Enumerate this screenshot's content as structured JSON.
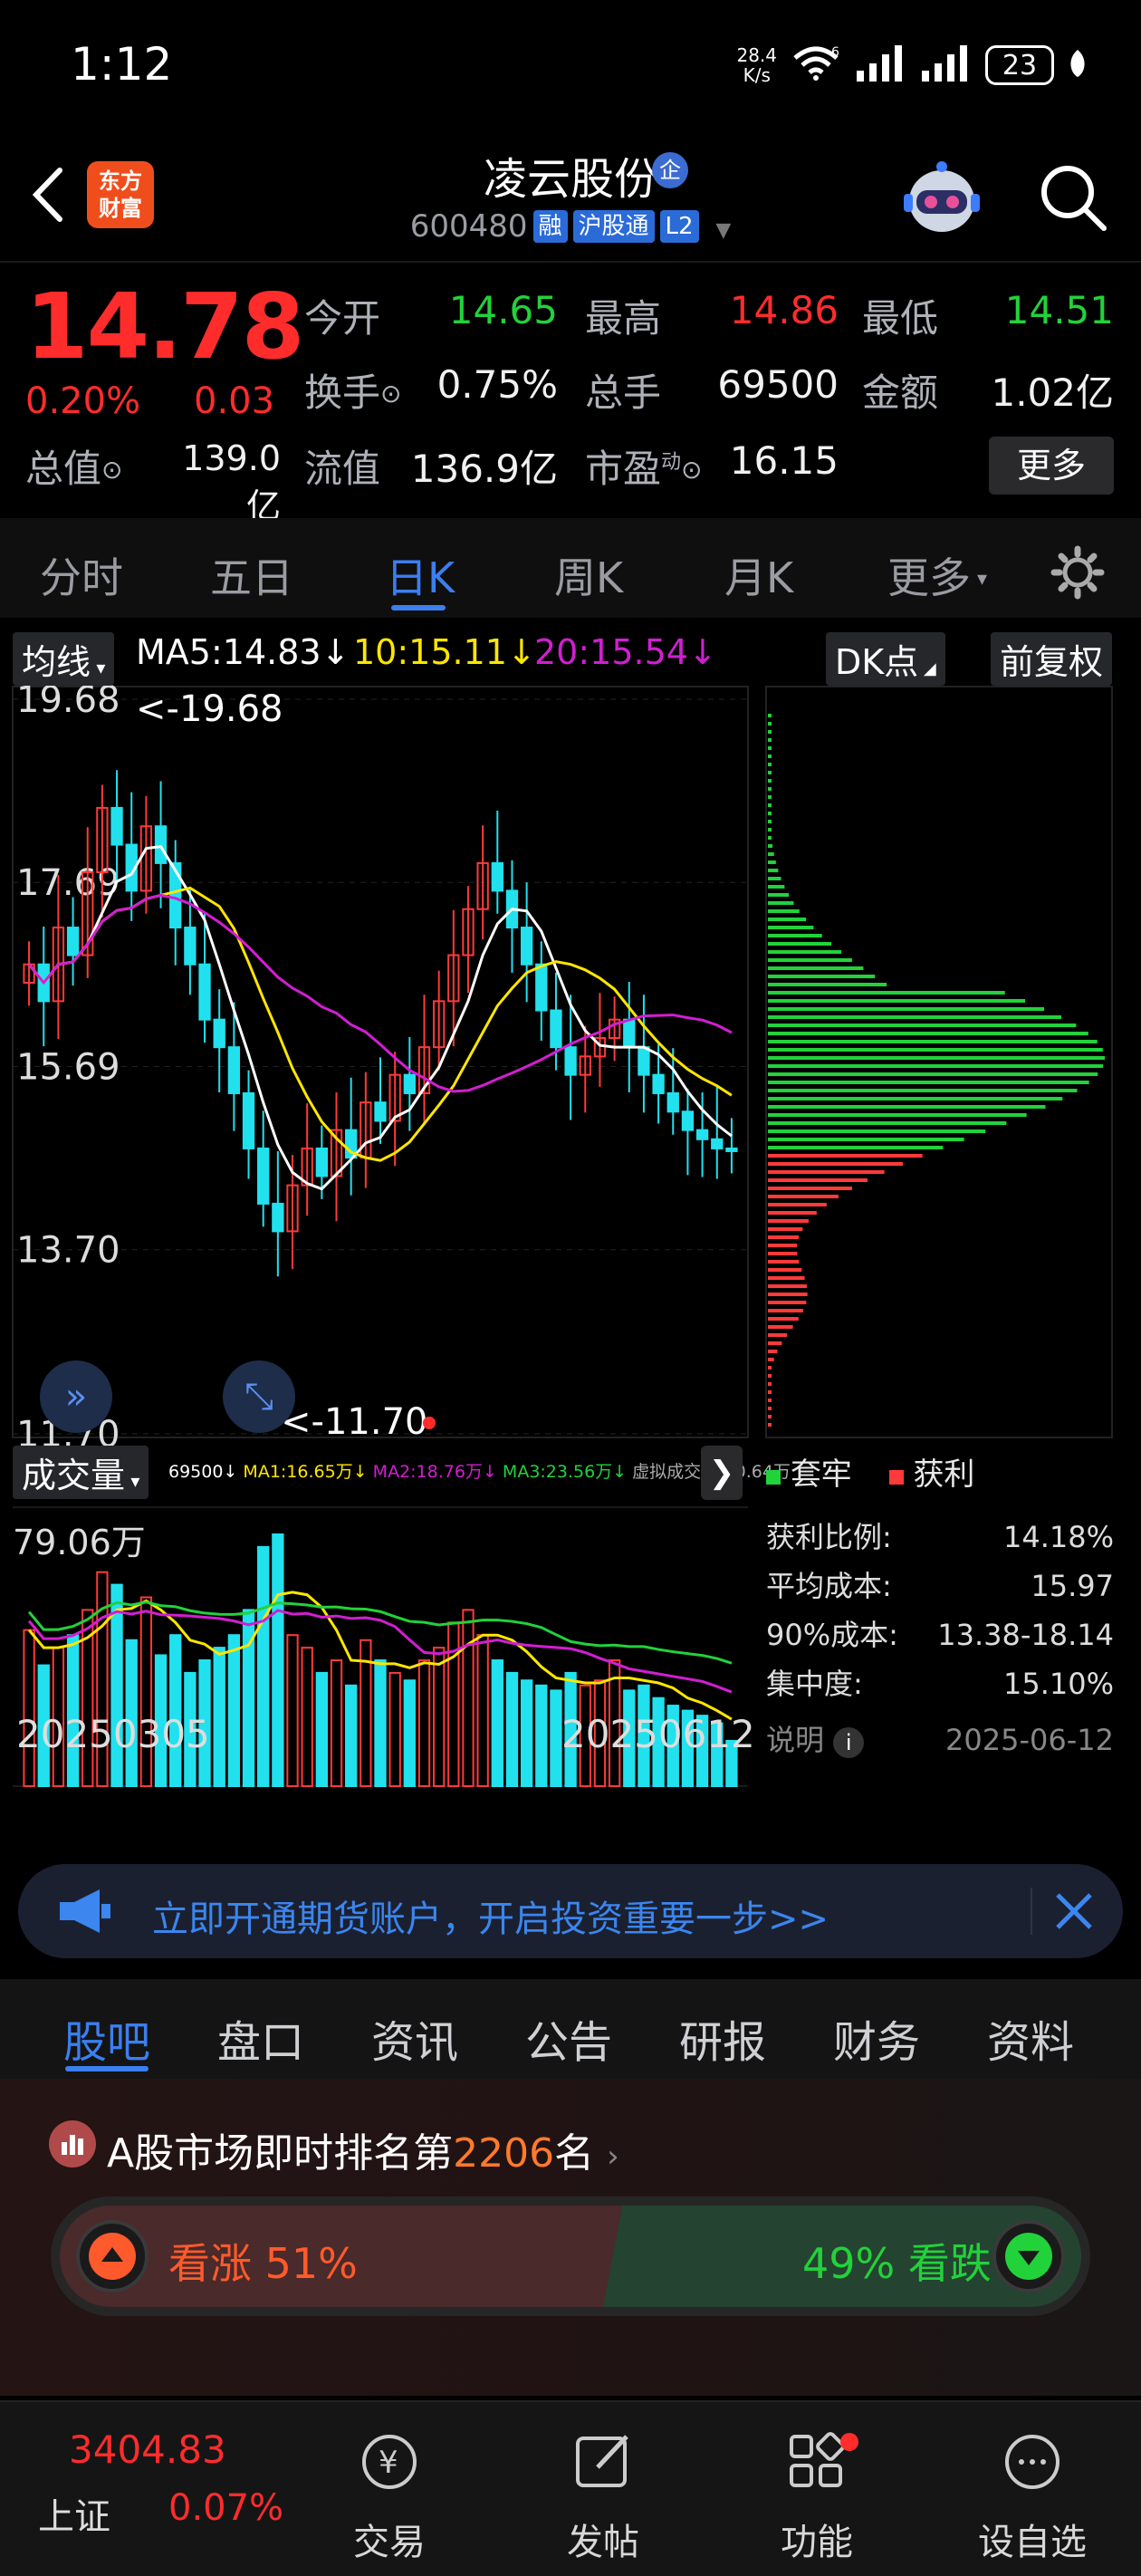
{
  "status_bar": {
    "time": "1:12",
    "net_speed_top": "28.4",
    "net_speed_unit": "K/s",
    "signal_label": "6",
    "battery": "23"
  },
  "header": {
    "app_logo": "东方\n财富",
    "stock_name": "凌云股份",
    "ent_badge": "企",
    "stock_code": "600480",
    "tags": [
      "融",
      "沪股通",
      "L2"
    ]
  },
  "quote": {
    "price": "14.78",
    "change_pct": "0.20%",
    "change": "0.03",
    "open_label": "今开",
    "open": "14.65",
    "high_label": "最高",
    "high": "14.86",
    "low_label": "最低",
    "low": "14.51",
    "turnover_label": "换手",
    "turnover": "0.75%",
    "volume_label": "总手",
    "volume": "69500",
    "amount_label": "金额",
    "amount": "1.02亿",
    "mktcap_label": "总值",
    "mktcap": "139.0亿",
    "float_label": "流值",
    "float": "136.9亿",
    "pe_label": "市盈",
    "pe_sup": "动",
    "pe": "16.15",
    "more_button": "更多"
  },
  "period_tabs": [
    "分时",
    "五日",
    "日K",
    "周K",
    "月K",
    "更多"
  ],
  "active_period": "日K",
  "ma_bar": {
    "selector": "均线",
    "ma5": "MA5:14.83",
    "ma10": "10:15.11",
    "ma20": "20:15.54",
    "dk_button": "DK点",
    "adjust_button": "前复权"
  },
  "chart_labels": {
    "y_ticks": [
      "19.68",
      "17.69",
      "15.69",
      "13.70",
      "11.70"
    ],
    "high_marker": "<-19.68",
    "low_marker": "<-11.70"
  },
  "volume_panel": {
    "selector": "成交量",
    "vol_label": "69500",
    "ma1": "MA1:16.65万",
    "ma2": "MA2:18.76万",
    "ma3": "MA3:23.56万",
    "virtual": "虚拟成交量:10.64万",
    "max_label": "79.06万",
    "start_date": "20250305",
    "end_date": "20250612"
  },
  "chip_panel": {
    "legend_trapped": "套牢",
    "legend_profit": "获利",
    "rows": [
      {
        "label": "获利比例:",
        "value": "14.18%"
      },
      {
        "label": "平均成本:",
        "value": "15.97"
      },
      {
        "label": "90%成本:",
        "value": "13.38-18.14"
      },
      {
        "label": "集中度:",
        "value": "15.10%"
      }
    ],
    "note_label": "说明",
    "date": "2025-06-12"
  },
  "banner": {
    "text": "立即开通期货账户，开启投资重要一步>>"
  },
  "bottom_tabs": [
    "股吧",
    "盘口",
    "资讯",
    "公告",
    "研报",
    "财务",
    "资料"
  ],
  "rank": {
    "prefix": "A股市场即时排名第",
    "rank": "2206",
    "suffix": "名"
  },
  "sentiment": {
    "bull_label": "看涨 51%",
    "bear_label": "49% 看跌",
    "bull_pct": 51,
    "bear_pct": 49
  },
  "bottom_nav": {
    "index_value": "3404.83",
    "index_name": "上证",
    "index_pct": "0.07%",
    "items": [
      "交易",
      "发帖",
      "功能",
      "设自选"
    ]
  },
  "colors": {
    "up": "#ff2c2c",
    "down": "#22d23a",
    "accent": "#3b7ff0",
    "cyan": "#22e1ee",
    "ma5": "#ffffff",
    "ma10": "#ffe600",
    "ma20": "#d21ed2"
  }
}
